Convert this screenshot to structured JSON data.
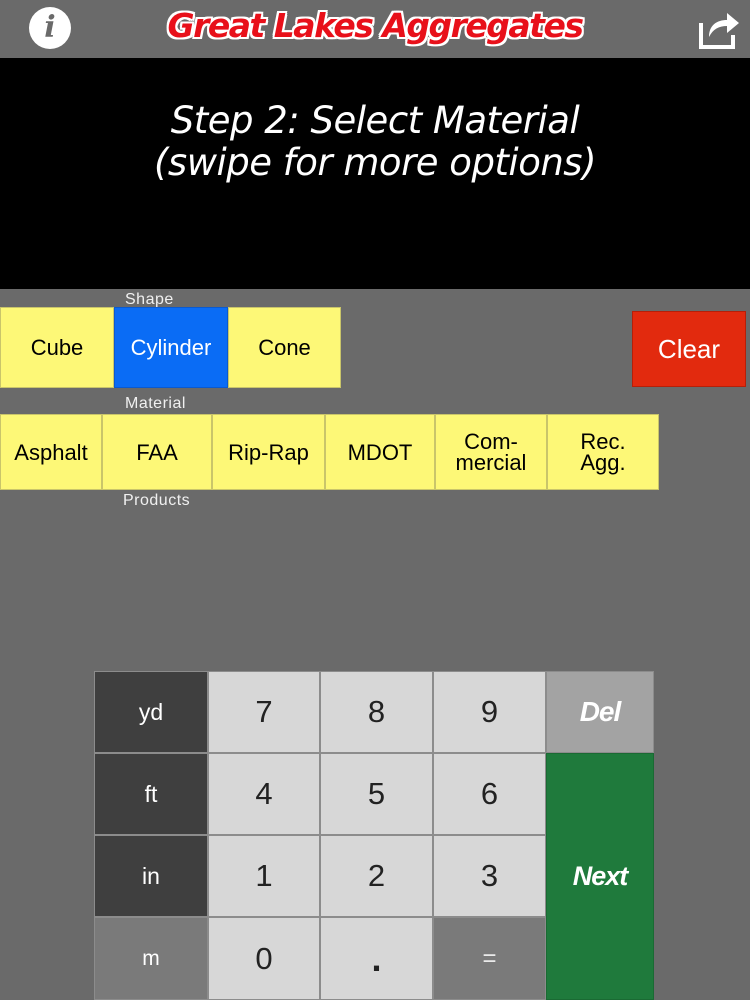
{
  "header": {
    "title": "Great Lakes Aggregates",
    "info_glyph": "i",
    "icons": {
      "info": "info-icon",
      "share": "share-icon"
    }
  },
  "banner": {
    "line1": "Step 2: Select Material",
    "line2": "(swipe for more options)"
  },
  "shape_section": {
    "label": "Shape",
    "options": [
      "Cube",
      "Cylinder",
      "Cone"
    ],
    "selected": "Cylinder"
  },
  "clear_label": "Clear",
  "material_section": {
    "label": "Material",
    "options": [
      "Asphalt",
      "FAA",
      "Rip-Rap",
      "MDOT",
      "Com-\nmercial",
      "Rec.\nAgg."
    ],
    "footer_label": "Products"
  },
  "keypad": {
    "units": [
      "yd",
      "ft",
      "in",
      "m"
    ],
    "digits": [
      "7",
      "8",
      "9",
      "4",
      "5",
      "6",
      "1",
      "2",
      "3",
      "0",
      "."
    ],
    "equals": "=",
    "del_label": "Del",
    "next_label": "Next"
  },
  "colors": {
    "background": "#6a6a6a",
    "title_red": "#e8101a",
    "option_yellow": "#fdf877",
    "selected_blue": "#0a6cf5",
    "clear_red": "#e22a0e",
    "next_green": "#1f7a3c",
    "key_light": "#d7d7d7",
    "key_dark": "#3f3f3f"
  }
}
